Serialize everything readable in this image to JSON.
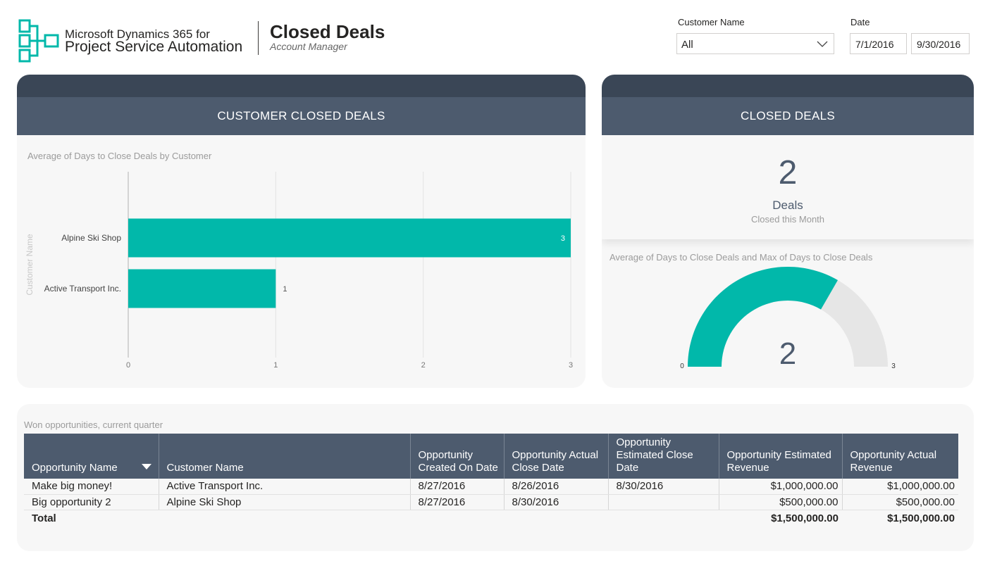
{
  "header": {
    "brand_line1": "Microsoft Dynamics 365 for",
    "brand_line2": "Project Service Automation",
    "title": "Closed Deals",
    "subtitle": "Account Manager"
  },
  "filters": {
    "customer_label": "Customer Name",
    "customer_value": "All",
    "date_label": "Date",
    "date_start": "7/1/2016",
    "date_end": "9/30/2016"
  },
  "customer_card": {
    "header": "CUSTOMER CLOSED DEALS",
    "chart_title": "Average of Days to Close Deals by Customer"
  },
  "closed_card": {
    "header": "CLOSED DEALS",
    "kpi_value": "2",
    "kpi_unit": "Deals",
    "kpi_caption": "Closed this Month",
    "gauge_title": "Average of Days to Close Deals and Max of Days to Close Deals"
  },
  "chart_data": [
    {
      "type": "bar",
      "orientation": "horizontal",
      "categories": [
        "Alpine Ski Shop",
        "Active Transport Inc."
      ],
      "values": [
        3,
        1
      ],
      "data_labels": [
        "3",
        "1"
      ],
      "ylabel": "Customer Name",
      "xlim": [
        0,
        3
      ],
      "xticks": [
        "0",
        "1",
        "2",
        "3"
      ],
      "grid": true,
      "color": "#01b8aa"
    },
    {
      "type": "gauge",
      "value": 2,
      "value_label": "2",
      "min": 0,
      "max": 3,
      "min_label": "0",
      "max_label": "3",
      "fill_color": "#01b8aa",
      "track_color": "#e6e6e6"
    }
  ],
  "table": {
    "title": "Won opportunities, current quarter",
    "columns": [
      "Opportunity Name",
      "Customer Name",
      "Opportunity Created On Date",
      "Opportunity Actual Close Date",
      "Opportunity Estimated Close Date",
      "Opportunity Estimated Revenue",
      "Opportunity Actual Revenue"
    ],
    "rows": [
      [
        "Make big money!",
        "Active Transport Inc.",
        "8/27/2016",
        "8/26/2016",
        "8/30/2016",
        "$1,000,000.00",
        "$1,000,000.00"
      ],
      [
        "Big opportunity 2",
        "Alpine Ski Shop",
        "8/27/2016",
        "8/30/2016",
        "",
        "$500,000.00",
        "$500,000.00"
      ]
    ],
    "total_label": "Total",
    "total_estimated": "$1,500,000.00",
    "total_actual": "$1,500,000.00"
  }
}
